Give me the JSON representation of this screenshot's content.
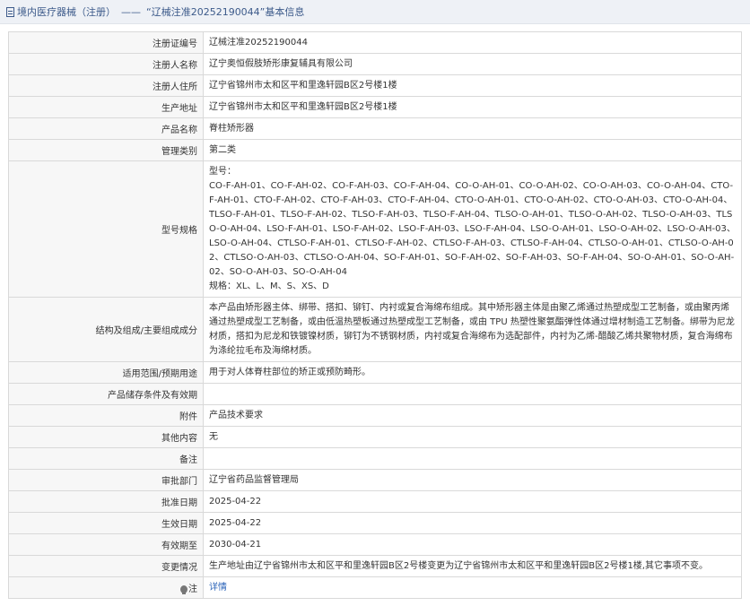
{
  "header": {
    "breadcrumb_category": "境内医疗器械（注册）",
    "separator": "——",
    "record_title": "“辽械注准20252190044”基本信息"
  },
  "rows": [
    {
      "label": "注册证编号",
      "value": "辽械注准20252190044"
    },
    {
      "label": "注册人名称",
      "value": "辽宁奥恒假肢矫形康复辅具有限公司"
    },
    {
      "label": "注册人住所",
      "value": "辽宁省锦州市太和区平和里逸轩园B区2号楼1楼"
    },
    {
      "label": "生产地址",
      "value": "辽宁省锦州市太和区平和里逸轩园B区2号楼1楼"
    },
    {
      "label": "产品名称",
      "value": "脊柱矫形器"
    },
    {
      "label": "管理类别",
      "value": "第二类"
    },
    {
      "label": "型号规格",
      "value_lines": [
        "型号：",
        "CO-F-AH-01、CO-F-AH-02、CO-F-AH-03、CO-F-AH-04、CO-O-AH-01、CO-O-AH-02、CO-O-AH-03、CO-O-AH-04、CTO-F-AH-01、CTO-F-AH-02、CTO-F-AH-03、CTO-F-AH-04、CTO-O-AH-01、CTO-O-AH-02、CTO-O-AH-03、CTO-O-AH-04、TLSO-F-AH-01、TLSO-F-AH-02、TLSO-F-AH-03、TLSO-F-AH-04、TLSO-O-AH-01、TLSO-O-AH-02、TLSO-O-AH-03、TLSO-O-AH-04、LSO-F-AH-01、LSO-F-AH-02、LSO-F-AH-03、LSO-F-AH-04、LSO-O-AH-01、LSO-O-AH-02、LSO-O-AH-03、LSO-O-AH-04、CTLSO-F-AH-01、CTLSO-F-AH-02、CTLSO-F-AH-03、CTLSO-F-AH-04、CTLSO-O-AH-01、CTLSO-O-AH-02、CTLSO-O-AH-03、CTLSO-O-AH-04、SO-F-AH-01、SO-F-AH-02、SO-F-AH-03、SO-F-AH-04、SO-O-AH-01、SO-O-AH-02、SO-O-AH-03、SO-O-AH-04",
        "规格：XL、L、M、S、XS、D"
      ]
    },
    {
      "label": "结构及组成/主要组成成分",
      "value": "本产品由矫形器主体、绑带、搭扣、铆钉、内衬或复合海绵布组成。其中矫形器主体是由聚乙烯通过热塑成型工艺制备，或由聚丙烯通过热塑成型工艺制备，或由低温热塑板通过热塑成型工艺制备，或由 TPU 热塑性聚氨酯弹性体通过增材制造工艺制备。绑带为尼龙材质，搭扣为尼龙和铁镀镍材质，铆钉为不锈钢材质，内衬或复合海绵布为选配部件，内衬为乙烯-醋酸乙烯共聚物材质，复合海绵布为涤纶拉毛布及海绵材质。"
    },
    {
      "label": "适用范围/预期用途",
      "value": "用于对人体脊柱部位的矫正或预防畸形。"
    },
    {
      "label": "产品储存条件及有效期",
      "value": ""
    },
    {
      "label": "附件",
      "value": "产品技术要求"
    },
    {
      "label": "其他内容",
      "value": "无"
    },
    {
      "label": "备注",
      "value": ""
    },
    {
      "label": "审批部门",
      "value": "辽宁省药品监督管理局"
    },
    {
      "label": "批准日期",
      "value": "2025-04-22"
    },
    {
      "label": "生效日期",
      "value": "2025-04-22"
    },
    {
      "label": "有效期至",
      "value": "2030-04-21"
    },
    {
      "label": "变更情况",
      "value": "生产地址由辽宁省锦州市太和区平和里逸轩园B区2号楼变更为辽宁省锦州市太和区平和里逸轩园B区2号楼1楼,其它事项不变。"
    }
  ],
  "details_row": {
    "label_icon": "hint-icon",
    "label": "注",
    "link": "详情"
  }
}
